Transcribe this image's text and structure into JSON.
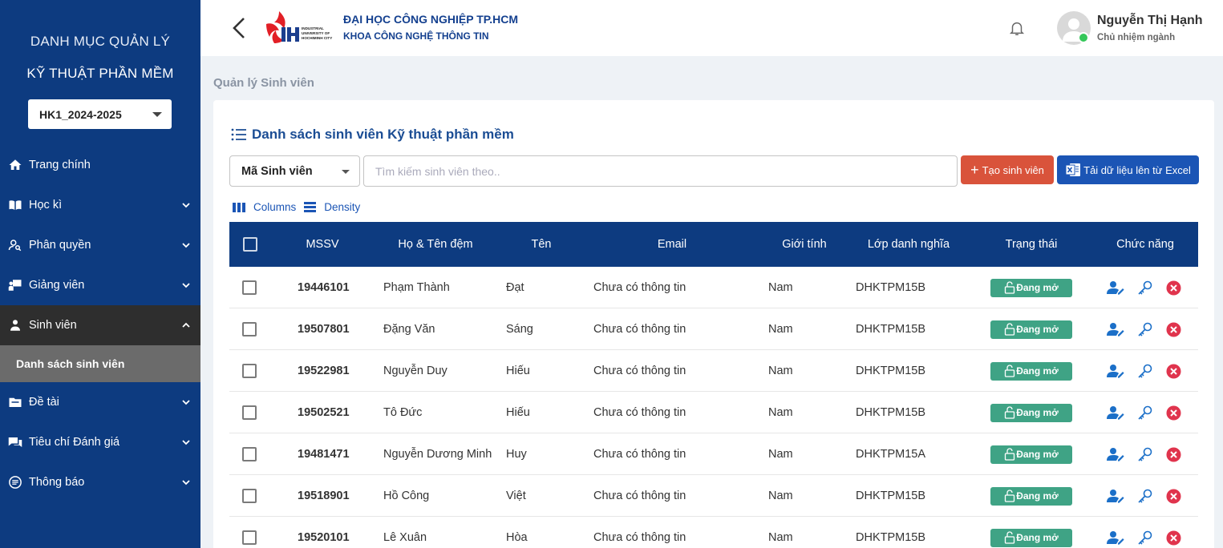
{
  "sidebar": {
    "title_line1": "DANH MỤC QUẢN LÝ",
    "title_line2": "KỸ THUẬT PHẦN MỀM",
    "semester": "HK1_2024-2025",
    "items": [
      {
        "label": "Trang chính",
        "icon": "home-icon"
      },
      {
        "label": "Học kì",
        "icon": "book-icon"
      },
      {
        "label": "Phân quyền",
        "icon": "user-search-icon"
      },
      {
        "label": "Giảng viên",
        "icon": "teacher-icon"
      },
      {
        "label": "Sinh viên",
        "icon": "student-icon"
      },
      {
        "label": "Đề tài",
        "icon": "folder-icon"
      },
      {
        "label": "Tiêu chí Đánh giá",
        "icon": "chat-icon"
      },
      {
        "label": "Thông báo",
        "icon": "notification-icon"
      }
    ],
    "sub_item": "Danh sách sinh viên"
  },
  "header": {
    "university": "ĐẠI HỌC CÔNG NGHIỆP TP.HCM",
    "faculty": "KHOA CÔNG NGHỆ THÔNG TIN",
    "user_name": "Nguyễn Thị Hạnh",
    "user_role": "Chủ nhiệm ngành"
  },
  "breadcrumb": "Quản lý Sinh viên",
  "card": {
    "title": "Danh sách sinh viên Kỹ thuật phần mềm",
    "filter_value": "Mã Sinh viên",
    "search_placeholder": "Tìm kiếm sinh viên theo..",
    "create_button": "Tạo sinh viên",
    "excel_button": "Tải dữ liệu lên từ Excel",
    "columns_label": "Columns",
    "density_label": "Density"
  },
  "table": {
    "headers": [
      "MSSV",
      "Họ & Tên đệm",
      "Tên",
      "Email",
      "Giới tính",
      "Lớp danh nghĩa",
      "Trạng thái",
      "Chức năng"
    ],
    "rows": [
      {
        "mssv": "19446101",
        "ho_ten_dem": "Phạm Thành",
        "ten": "Đạt",
        "email": "Chưa có thông tin",
        "gioi_tinh": "Nam",
        "lop": "DHKTPM15B",
        "trang_thai": "Đang mở"
      },
      {
        "mssv": "19507801",
        "ho_ten_dem": "Đặng Văn",
        "ten": "Sáng",
        "email": "Chưa có thông tin",
        "gioi_tinh": "Nam",
        "lop": "DHKTPM15B",
        "trang_thai": "Đang mở"
      },
      {
        "mssv": "19522981",
        "ho_ten_dem": "Nguyễn Duy",
        "ten": "Hiếu",
        "email": "Chưa có thông tin",
        "gioi_tinh": "Nam",
        "lop": "DHKTPM15B",
        "trang_thai": "Đang mở"
      },
      {
        "mssv": "19502521",
        "ho_ten_dem": "Tô Đức",
        "ten": "Hiếu",
        "email": "Chưa có thông tin",
        "gioi_tinh": "Nam",
        "lop": "DHKTPM15B",
        "trang_thai": "Đang mở"
      },
      {
        "mssv": "19481471",
        "ho_ten_dem": "Nguyễn Dương Minh",
        "ten": "Huy",
        "email": "Chưa có thông tin",
        "gioi_tinh": "Nam",
        "lop": "DHKTPM15A",
        "trang_thai": "Đang mở"
      },
      {
        "mssv": "19518901",
        "ho_ten_dem": "Hồ Công",
        "ten": "Việt",
        "email": "Chưa có thông tin",
        "gioi_tinh": "Nam",
        "lop": "DHKTPM15B",
        "trang_thai": "Đang mở"
      },
      {
        "mssv": "19520101",
        "ho_ten_dem": "Lê Xuân",
        "ten": "Hòa",
        "email": "Chưa có thông tin",
        "gioi_tinh": "Nam",
        "lop": "DHKTPM15B",
        "trang_thai": "Đang mở"
      }
    ]
  },
  "colors": {
    "sidebar_bg": "#0d3b80",
    "table_header_bg": "#0d3b80",
    "create_button": "#d9533b",
    "excel_button": "#1b55b5",
    "status_badge": "#3fa385",
    "delete_icon": "#e0344d"
  }
}
